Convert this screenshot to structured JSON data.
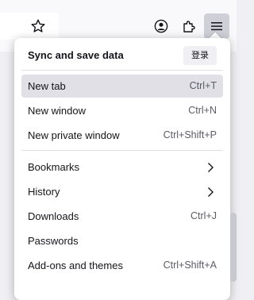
{
  "toolbar": {
    "bookmark_star_icon": "star-icon",
    "account_icon": "account-icon",
    "extensions_icon": "puzzle-icon",
    "menu_icon": "hamburger-icon"
  },
  "menu": {
    "sync_title": "Sync and save data",
    "sign_in_label": "登录",
    "items": [
      {
        "label": "New tab",
        "shortcut": "Ctrl+T"
      },
      {
        "label": "New window",
        "shortcut": "Ctrl+N"
      },
      {
        "label": "New private window",
        "shortcut": "Ctrl+Shift+P"
      },
      {
        "label": "Bookmarks",
        "shortcut": ""
      },
      {
        "label": "History",
        "shortcut": ""
      },
      {
        "label": "Downloads",
        "shortcut": "Ctrl+J"
      },
      {
        "label": "Passwords",
        "shortcut": ""
      },
      {
        "label": "Add-ons and themes",
        "shortcut": "Ctrl+Shift+A"
      }
    ]
  }
}
